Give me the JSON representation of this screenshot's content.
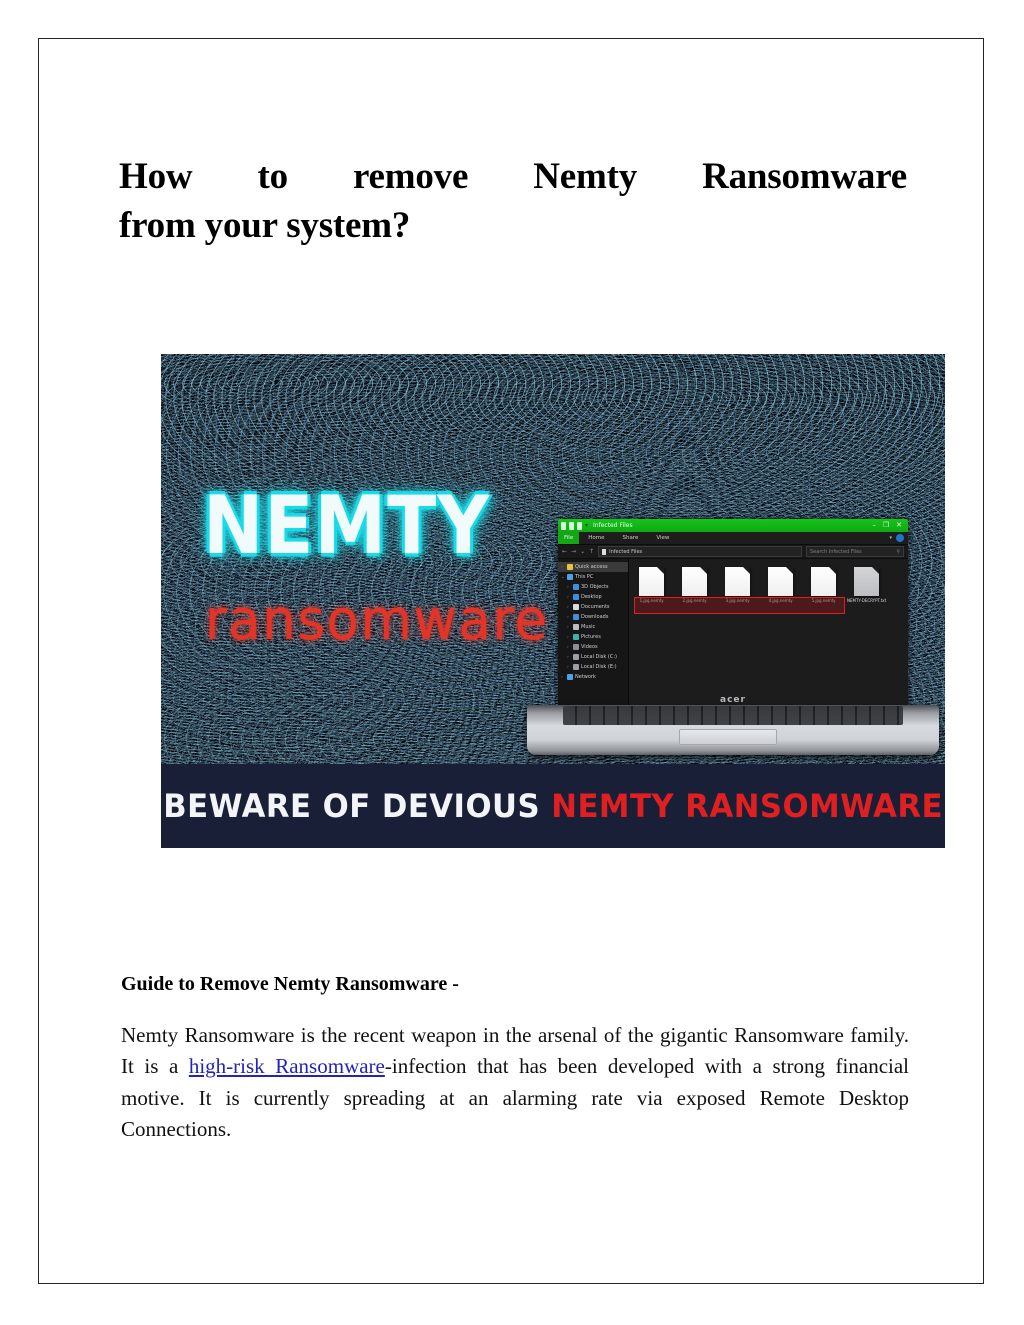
{
  "document": {
    "title_line1": "How to remove Nemty Ransomware",
    "title_line2": "from your system?",
    "subheading": "Guide to Remove Nemty Ransomware -",
    "paragraph_part1": "Nemty Ransomware is the recent weapon in the arsenal of the gigantic Ransomware family. It is a ",
    "paragraph_link": "high-risk Ransomware",
    "paragraph_part2": "-infection that has been developed with a strong financial motive. It is currently spreading at an alarming rate via exposed Remote Desktop Connections.",
    "link_color": "#2323bb"
  },
  "hero": {
    "wordmark_main": "NEMTY",
    "wordmark_sub": "ransomware",
    "wordmark_main_color": "#f2fbfc",
    "wordmark_main_glow": "#19dbe8",
    "wordmark_sub_color": "#e23427",
    "banner_bg": "#1a1f38",
    "banner_text_white": "BEWARE OF DEVIOUS ",
    "banner_text_red": "NEMTY RANSOMWARE",
    "banner_red_color": "#e02020",
    "laptop_brand": "acer"
  },
  "explorer": {
    "window_title": "Infected Files",
    "titlebar_color": "#13a617",
    "window_controls": {
      "minimize": "–",
      "maximize": "❐",
      "close": "✕"
    },
    "ribbon_tabs": [
      {
        "label": "File",
        "active": true
      },
      {
        "label": "Home",
        "active": false
      },
      {
        "label": "Share",
        "active": false
      },
      {
        "label": "View",
        "active": false
      }
    ],
    "nav_buttons": {
      "back": "←",
      "forward": "→",
      "up": "↑",
      "recent": "⌄"
    },
    "address_path": "Infected Files",
    "search_placeholder": "Search Infected Files",
    "search_icon": "⚲",
    "sidebar": [
      {
        "label": "Quick access",
        "icon": "ico-star",
        "indent": 0,
        "chevron": "›",
        "selected": true
      },
      {
        "label": "This PC",
        "icon": "ico-pc",
        "indent": 0,
        "chevron": "⌄",
        "selected": false
      },
      {
        "label": "3D Objects",
        "icon": "ico-3d",
        "indent": 1,
        "chevron": "›",
        "selected": false
      },
      {
        "label": "Desktop",
        "icon": "ico-desk",
        "indent": 1,
        "chevron": "›",
        "selected": false
      },
      {
        "label": "Documents",
        "icon": "ico-doc",
        "indent": 1,
        "chevron": "›",
        "selected": false
      },
      {
        "label": "Downloads",
        "icon": "ico-dl",
        "indent": 1,
        "chevron": "›",
        "selected": false
      },
      {
        "label": "Music",
        "icon": "ico-music",
        "indent": 1,
        "chevron": "›",
        "selected": false
      },
      {
        "label": "Pictures",
        "icon": "ico-pics",
        "indent": 1,
        "chevron": "›",
        "selected": false
      },
      {
        "label": "Videos",
        "icon": "ico-vid",
        "indent": 1,
        "chevron": "›",
        "selected": false
      },
      {
        "label": "Local Disk (C:)",
        "icon": "ico-disk",
        "indent": 1,
        "chevron": "›",
        "selected": false
      },
      {
        "label": "Local Disk (E:)",
        "icon": "ico-disk",
        "indent": 1,
        "chevron": "›",
        "selected": false
      },
      {
        "label": "Network",
        "icon": "ico-net",
        "indent": 0,
        "chevron": "›",
        "selected": false
      }
    ],
    "files": [
      {
        "label": "1.jpg.nemty",
        "encrypted": true,
        "grey": false
      },
      {
        "label": "2.jpg.nemty",
        "encrypted": true,
        "grey": false
      },
      {
        "label": "3.jpg.nemty",
        "encrypted": true,
        "grey": false
      },
      {
        "label": "4.jpg.nemty",
        "encrypted": true,
        "grey": false
      },
      {
        "label": "5.jpg.nemty",
        "encrypted": true,
        "grey": false
      },
      {
        "label": "NEMTY-DECRYPT.txt",
        "encrypted": false,
        "grey": true
      }
    ],
    "highlight_box_color": "#e02020"
  }
}
